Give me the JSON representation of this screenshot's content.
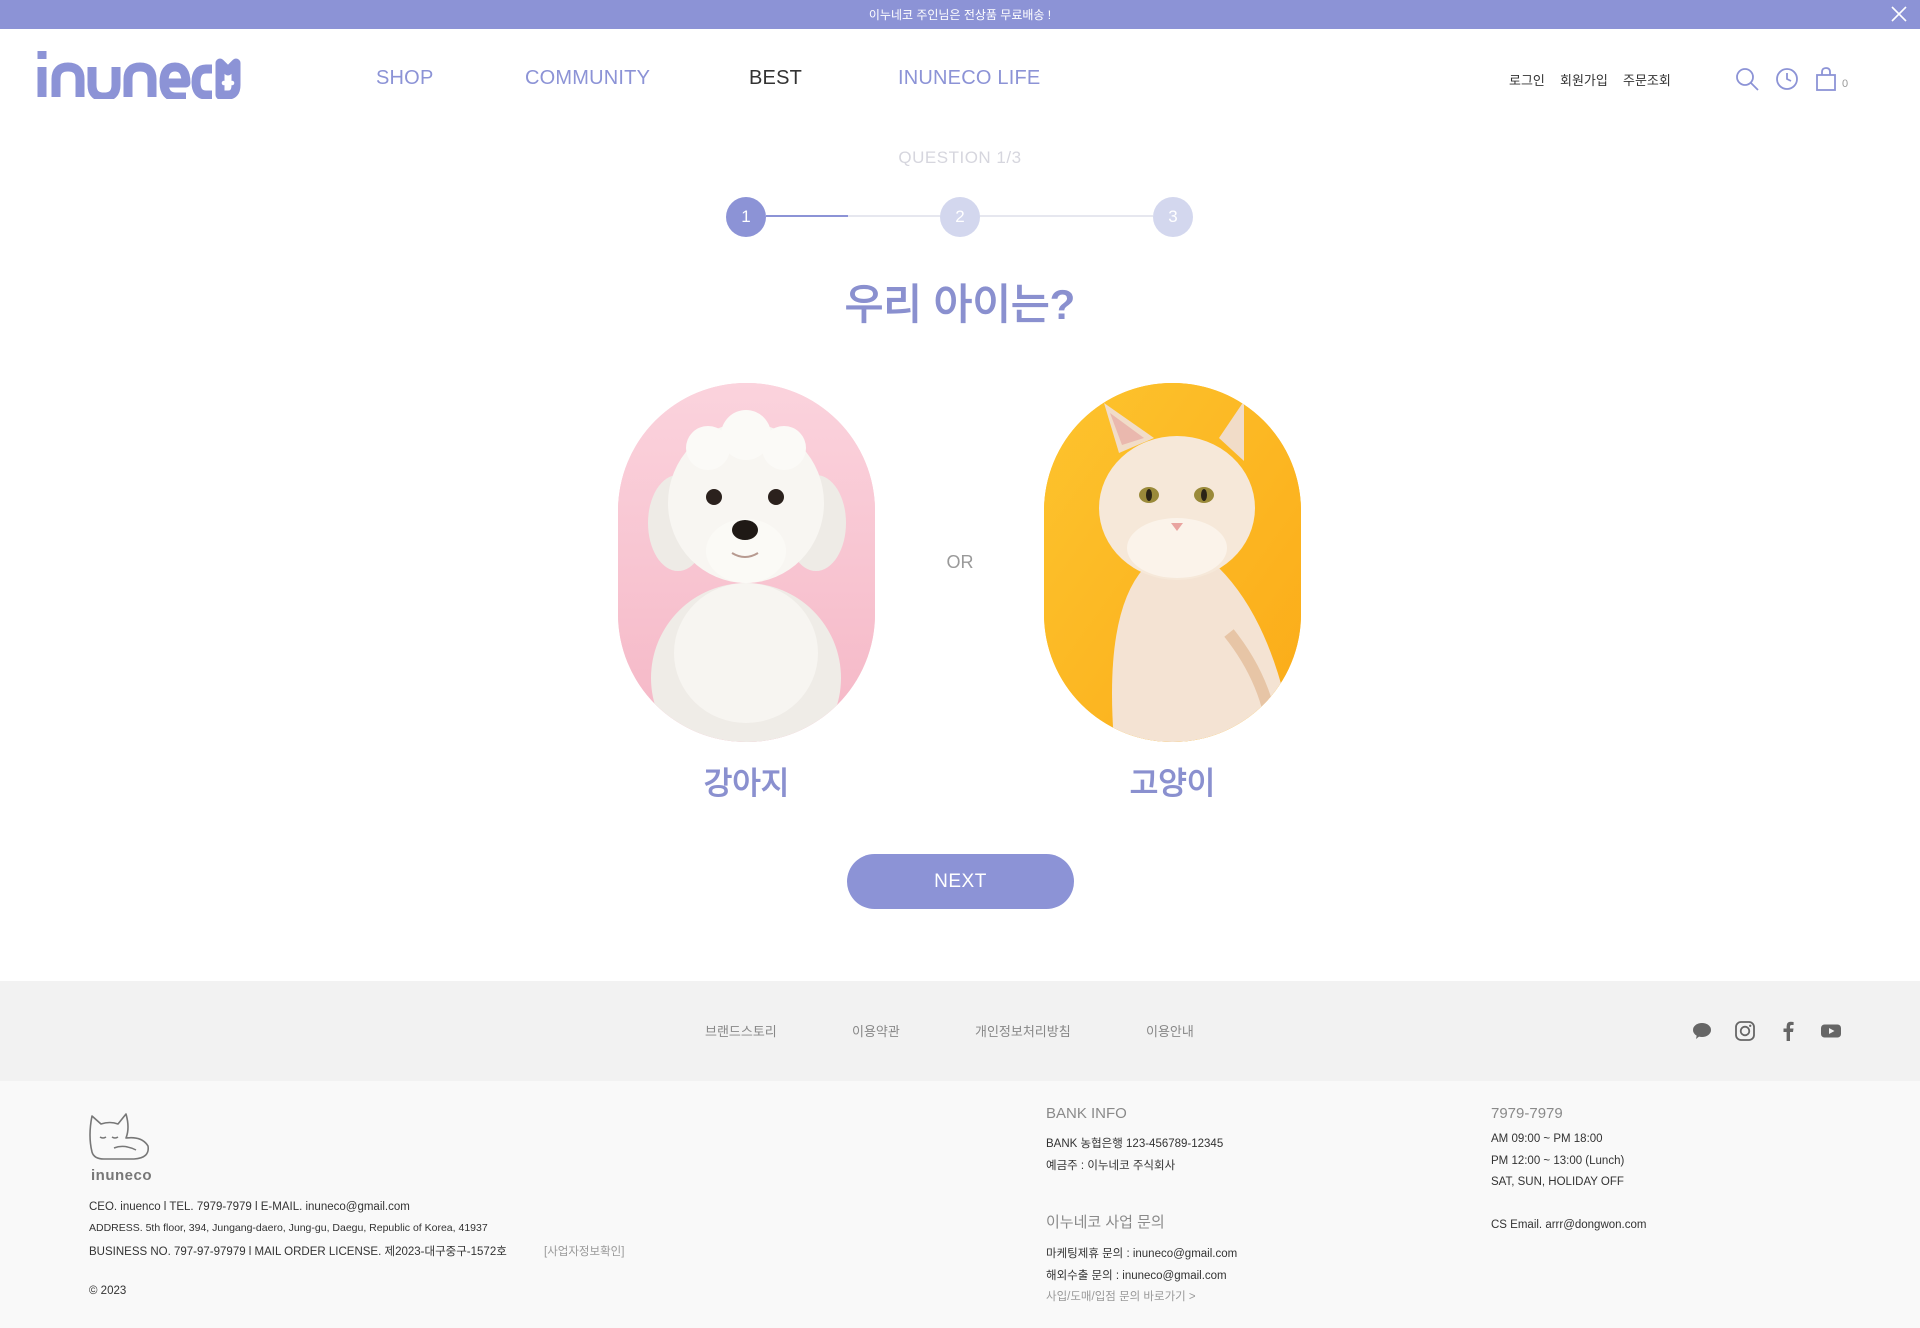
{
  "banner": {
    "text": "이누네코 주인님은 전상품 무료배송 !"
  },
  "header": {
    "logo_text": "inuneco",
    "nav": [
      "SHOP",
      "COMMUNITY",
      "BEST",
      "INUNECO LIFE"
    ],
    "util": [
      "로그인",
      "회원가입",
      "주문조회"
    ],
    "cart_count": "0"
  },
  "quiz": {
    "progress_label": "QUESTION 1/3",
    "steps": [
      "1",
      "2",
      "3"
    ],
    "current_step": 1,
    "question": "우리 아이는?",
    "options": [
      {
        "label": "강아지",
        "bg": "#f8c6d2"
      },
      {
        "label": "고양이",
        "bg": "#fdb823"
      }
    ],
    "or_label": "OR",
    "next_label": "NEXT"
  },
  "footer": {
    "links": [
      "브랜드스토리",
      "이용약관",
      "개인정보처리방침",
      "이용안내"
    ],
    "social_icons": [
      "kakao-talk-icon",
      "instagram-icon",
      "facebook-icon",
      "youtube-icon"
    ],
    "company": {
      "logo_text": "inuneco",
      "line1": "CEO. inuenco l TEL. 7979-7979 l E-MAIL. inuneco@gmail.com",
      "line2": "ADDRESS. 5th floor, 394, Jungang-daero, Jung-gu, Daegu, Republic of Korea, 41937",
      "line3": "BUSINESS NO. 797-97-97979 l MAIL ORDER LICENSE. 제2023-대구중구-1572호",
      "biz_check": "[사업자정보확인]",
      "copyright": "© 2023"
    },
    "bank": {
      "title": "BANK INFO",
      "line1": "BANK 농협은행 123-456789-12345",
      "line2": "예금주 : 이누네코 주식회사"
    },
    "business": {
      "title": "이누네코 사업 문의",
      "line1": "마케팅제휴 문의 : inuneco@gmail.com",
      "line2": "해외수출 문의 : inuneco@gmail.com",
      "link": "사입/도매/입점 문의 바로가기 >"
    },
    "cs": {
      "title": "7979-7979",
      "line1": "AM 09:00 ~ PM 18:00",
      "line2": "PM 12:00 ~ 13:00 (Lunch)",
      "line3": "SAT, SUN, HOLIDAY OFF",
      "email": "CS Email. arrr@dongwon.com"
    }
  },
  "colors": {
    "accent": "#8c93d6",
    "accent_text": "#8a90cf",
    "step_inactive": "#d3d7ee"
  }
}
